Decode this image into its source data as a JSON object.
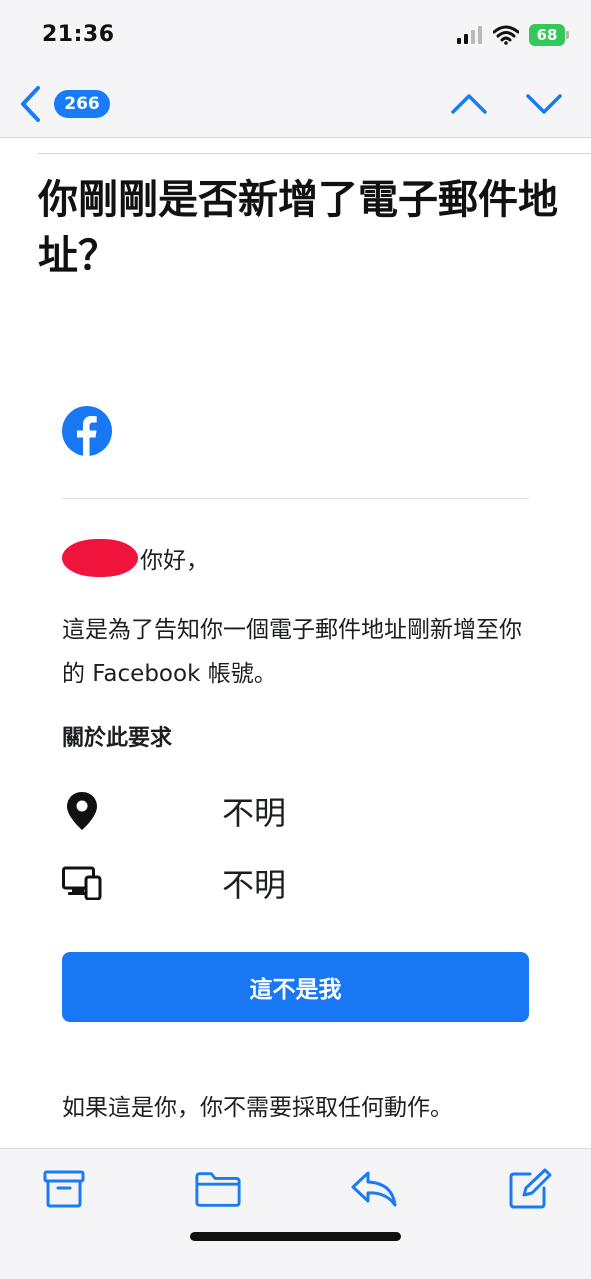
{
  "status_bar": {
    "time": "21:36",
    "battery_percent": "68",
    "icons": [
      "signal-icon",
      "wifi-icon",
      "battery-icon"
    ]
  },
  "nav": {
    "unread_count": "266",
    "icons": [
      "back-chevron-icon",
      "chevron-up-icon",
      "chevron-down-icon"
    ]
  },
  "email": {
    "subject": "你剛剛是否新增了電子郵件地址？",
    "brand_icon": "facebook-logo-icon",
    "greeting_suffix": "你好，",
    "body": "這是為了告知你一個電子郵件地址剛新增至你的 Facebook 帳號。",
    "section_title": "關於此要求",
    "location_value": "不明",
    "device_value": "不明",
    "not_me_button": "這不是我",
    "footer_note": "如果這是你，你不需要採取任何動作。"
  },
  "toolbar": {
    "icons": [
      "archive-icon",
      "folder-icon",
      "reply-icon",
      "compose-icon"
    ]
  },
  "colors": {
    "ios_blue": "#1a7cf5",
    "facebook_blue": "#1877f2",
    "battery_green": "#34c759",
    "redaction_red": "#f0143c"
  }
}
